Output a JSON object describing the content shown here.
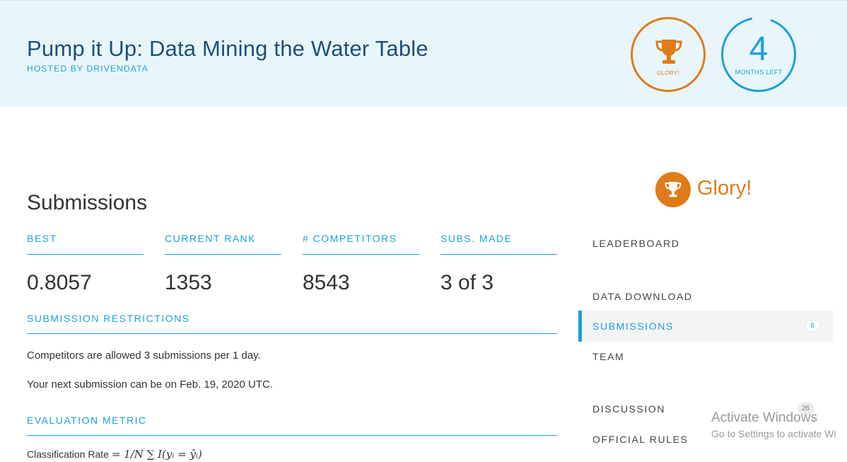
{
  "banner": {
    "title": "Pump it Up: Data Mining the Water Table",
    "host": "HOSTED BY DRIVENDATA",
    "prize_label": "GLORY!",
    "time_value": "4",
    "time_label": "MONTHS LEFT"
  },
  "main": {
    "title": "Submissions",
    "stats": [
      {
        "label": "BEST",
        "value": "0.8057"
      },
      {
        "label": "CURRENT RANK",
        "value": "1353"
      },
      {
        "label": "# COMPETITORS",
        "value": "8543"
      },
      {
        "label": "SUBS. MADE",
        "value": "3 of 3"
      }
    ],
    "restrictions": {
      "heading": "SUBMISSION RESTRICTIONS",
      "line1": "Competitors are allowed 3 submissions per 1 day.",
      "line2": "Your next submission can be on Feb. 19, 2020 UTC."
    },
    "metric": {
      "heading": "EVALUATION METRIC",
      "label": "Classification Rate",
      "formula": "= 1/N ∑ I(yᵢ = ŷᵢ)"
    }
  },
  "sidebar": {
    "prize_text": "Glory!",
    "items": [
      {
        "label": "LEADERBOARD",
        "badge": ""
      },
      {
        "label": "DATA DOWNLOAD",
        "badge": ""
      },
      {
        "label": "SUBMISSIONS",
        "badge": "6"
      },
      {
        "label": "TEAM",
        "badge": ""
      },
      {
        "label": "DISCUSSION",
        "badge": "26"
      },
      {
        "label": "OFFICIAL RULES",
        "badge": ""
      }
    ]
  },
  "watermark": {
    "title": "Activate Windows",
    "subtitle": "Go to Settings to activate Wi"
  },
  "colors": {
    "accent": "#1ba1dc",
    "prize": "#e07b1a",
    "banner_bg": "#e8f6fb",
    "title_dark": "#1f4e79"
  }
}
